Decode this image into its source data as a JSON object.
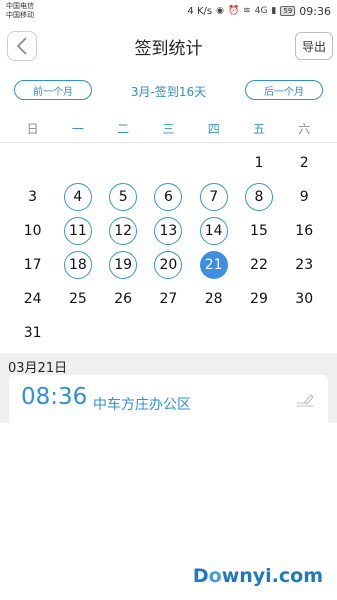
{
  "status_bar": {
    "carrier_1": "中国电信",
    "carrier_2": "中国移动",
    "speed": "4 K/s",
    "signal_4g": "4G",
    "battery": "59",
    "time": "09:36"
  },
  "header": {
    "title": "签到统计",
    "export_label": "导出",
    "back_icon": "chevron-left-icon"
  },
  "month_nav": {
    "prev_label": "前一个月",
    "month_label": "3月-签到16天",
    "next_label": "后一个月"
  },
  "weekdays": [
    "日",
    "一",
    "二",
    "三",
    "四",
    "五",
    "六"
  ],
  "calendar": {
    "weeks": [
      [
        {
          "day": "",
          "state": "empty"
        },
        {
          "day": "",
          "state": "empty"
        },
        {
          "day": "",
          "state": "empty"
        },
        {
          "day": "",
          "state": "empty"
        },
        {
          "day": "",
          "state": "empty"
        },
        {
          "day": "1",
          "state": "normal"
        },
        {
          "day": "2",
          "state": "normal"
        }
      ],
      [
        {
          "day": "3",
          "state": "normal"
        },
        {
          "day": "4",
          "state": "signed"
        },
        {
          "day": "5",
          "state": "signed"
        },
        {
          "day": "6",
          "state": "signed"
        },
        {
          "day": "7",
          "state": "signed"
        },
        {
          "day": "8",
          "state": "signed"
        },
        {
          "day": "9",
          "state": "normal"
        }
      ],
      [
        {
          "day": "10",
          "state": "normal"
        },
        {
          "day": "11",
          "state": "signed"
        },
        {
          "day": "12",
          "state": "signed"
        },
        {
          "day": "13",
          "state": "signed"
        },
        {
          "day": "14",
          "state": "signed"
        },
        {
          "day": "15",
          "state": "normal"
        },
        {
          "day": "16",
          "state": "normal"
        }
      ],
      [
        {
          "day": "17",
          "state": "normal"
        },
        {
          "day": "18",
          "state": "signed"
        },
        {
          "day": "19",
          "state": "signed"
        },
        {
          "day": "20",
          "state": "signed"
        },
        {
          "day": "21",
          "state": "today"
        },
        {
          "day": "22",
          "state": "normal"
        },
        {
          "day": "23",
          "state": "normal"
        }
      ],
      [
        {
          "day": "24",
          "state": "normal"
        },
        {
          "day": "25",
          "state": "normal"
        },
        {
          "day": "26",
          "state": "normal"
        },
        {
          "day": "27",
          "state": "normal"
        },
        {
          "day": "28",
          "state": "normal"
        },
        {
          "day": "29",
          "state": "normal"
        },
        {
          "day": "30",
          "state": "normal"
        }
      ],
      [
        {
          "day": "31",
          "state": "normal"
        },
        {
          "day": "",
          "state": "empty"
        },
        {
          "day": "",
          "state": "empty"
        },
        {
          "day": "",
          "state": "empty"
        },
        {
          "day": "",
          "state": "empty"
        },
        {
          "day": "",
          "state": "empty"
        },
        {
          "day": "",
          "state": "empty"
        }
      ]
    ]
  },
  "record": {
    "date": "03月21日",
    "time": "08:36",
    "place": "中车方庄办公区",
    "edit_icon": "edit-signature-icon"
  },
  "watermark": {
    "text_1": "D",
    "text_o": "o",
    "text_2": "wnyi.com"
  },
  "colors": {
    "accent": "#2e8fd6",
    "today_fill": "#3d8fe3",
    "section_bg": "#efefef"
  }
}
